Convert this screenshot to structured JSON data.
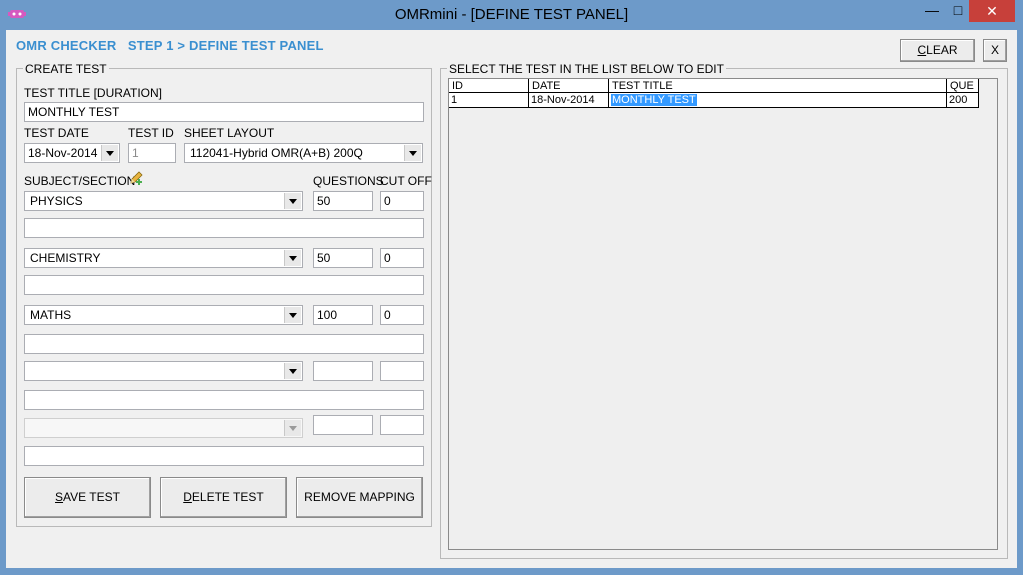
{
  "window": {
    "title": "OMRmini - [DEFINE TEST PANEL]",
    "minimize": "—",
    "maximize": "□",
    "close": "✕"
  },
  "breadcrumb": "OMR CHECKER   STEP 1 > DEFINE TEST PANEL",
  "toolbar": {
    "clear_label": "CLEAR",
    "close_label": "X"
  },
  "create_test": {
    "group_title": "CREATE TEST",
    "title_label": "TEST TITLE [DURATION]",
    "title_value": "MONTHLY TEST",
    "date_label": "TEST DATE",
    "date_value": "18-Nov-2014",
    "id_label": "TEST ID",
    "id_value": "1",
    "layout_label": "SHEET LAYOUT",
    "layout_value": "112041-Hybrid OMR(A+B) 200Q",
    "subject_label": "SUBJECT/SECTION",
    "questions_label": "QUESTIONS",
    "cutoff_label": "CUT OFF",
    "subjects": [
      {
        "name": "PHYSICS",
        "questions": "50",
        "cutoff": "0",
        "note": ""
      },
      {
        "name": "CHEMISTRY",
        "questions": "50",
        "cutoff": "0",
        "note": ""
      },
      {
        "name": "MATHS",
        "questions": "100",
        "cutoff": "0",
        "note": ""
      },
      {
        "name": "",
        "questions": "",
        "cutoff": "",
        "note": ""
      },
      {
        "name": "",
        "questions": "",
        "cutoff": "",
        "note": ""
      }
    ],
    "save_label": "SAVE TEST",
    "delete_label": "DELETE TEST",
    "remove_label": "REMOVE MAPPING"
  },
  "test_list": {
    "group_title": "SELECT THE TEST IN THE LIST BELOW TO EDIT",
    "columns": [
      "ID",
      "DATE",
      "TEST TITLE",
      "QUE"
    ],
    "rows": [
      [
        "1",
        "18-Nov-2014",
        "MONTHLY TEST",
        "200"
      ]
    ]
  },
  "colors": {
    "titlebar": "#6d9ac9",
    "accent": "#3a8fd0",
    "close": "#c7403a",
    "selection": "#3399ff"
  }
}
